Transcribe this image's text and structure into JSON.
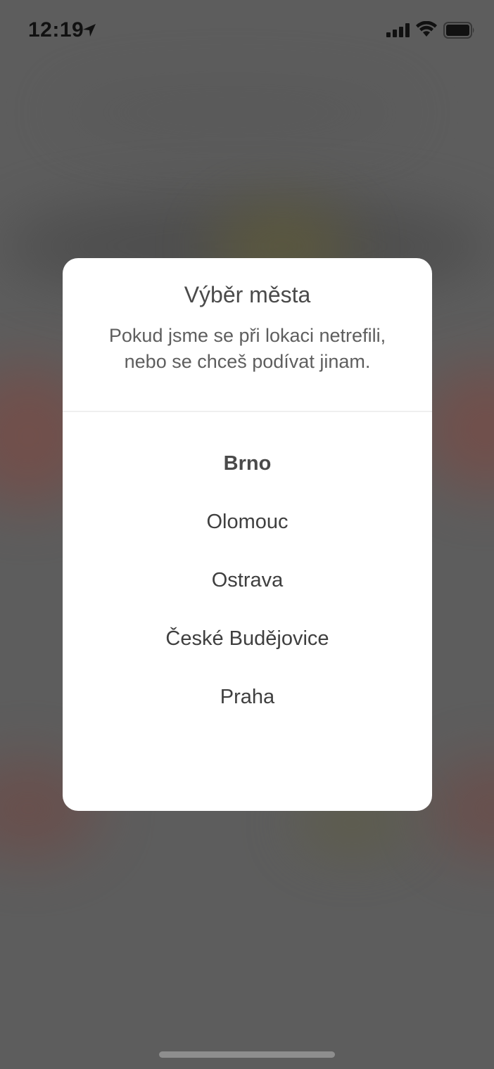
{
  "status_bar": {
    "time": "12:19",
    "icons": [
      "location-arrow-icon",
      "cellular-signal-icon",
      "wifi-icon",
      "battery-icon"
    ]
  },
  "modal": {
    "title": "Výběr města",
    "subtitle_line1": "Pokud jsme se při lokaci netrefili,",
    "subtitle_line2": "nebo se chceš podívat jinam.",
    "cities": [
      {
        "label": "Brno",
        "selected": true
      },
      {
        "label": "Olomouc",
        "selected": false
      },
      {
        "label": "Ostrava",
        "selected": false
      },
      {
        "label": "České Budějovice",
        "selected": false
      },
      {
        "label": "Praha",
        "selected": false
      }
    ]
  },
  "colors": {
    "overlay": "#5d5d5d",
    "modal_background": "#ffffff",
    "text": "#4a4a4a"
  }
}
